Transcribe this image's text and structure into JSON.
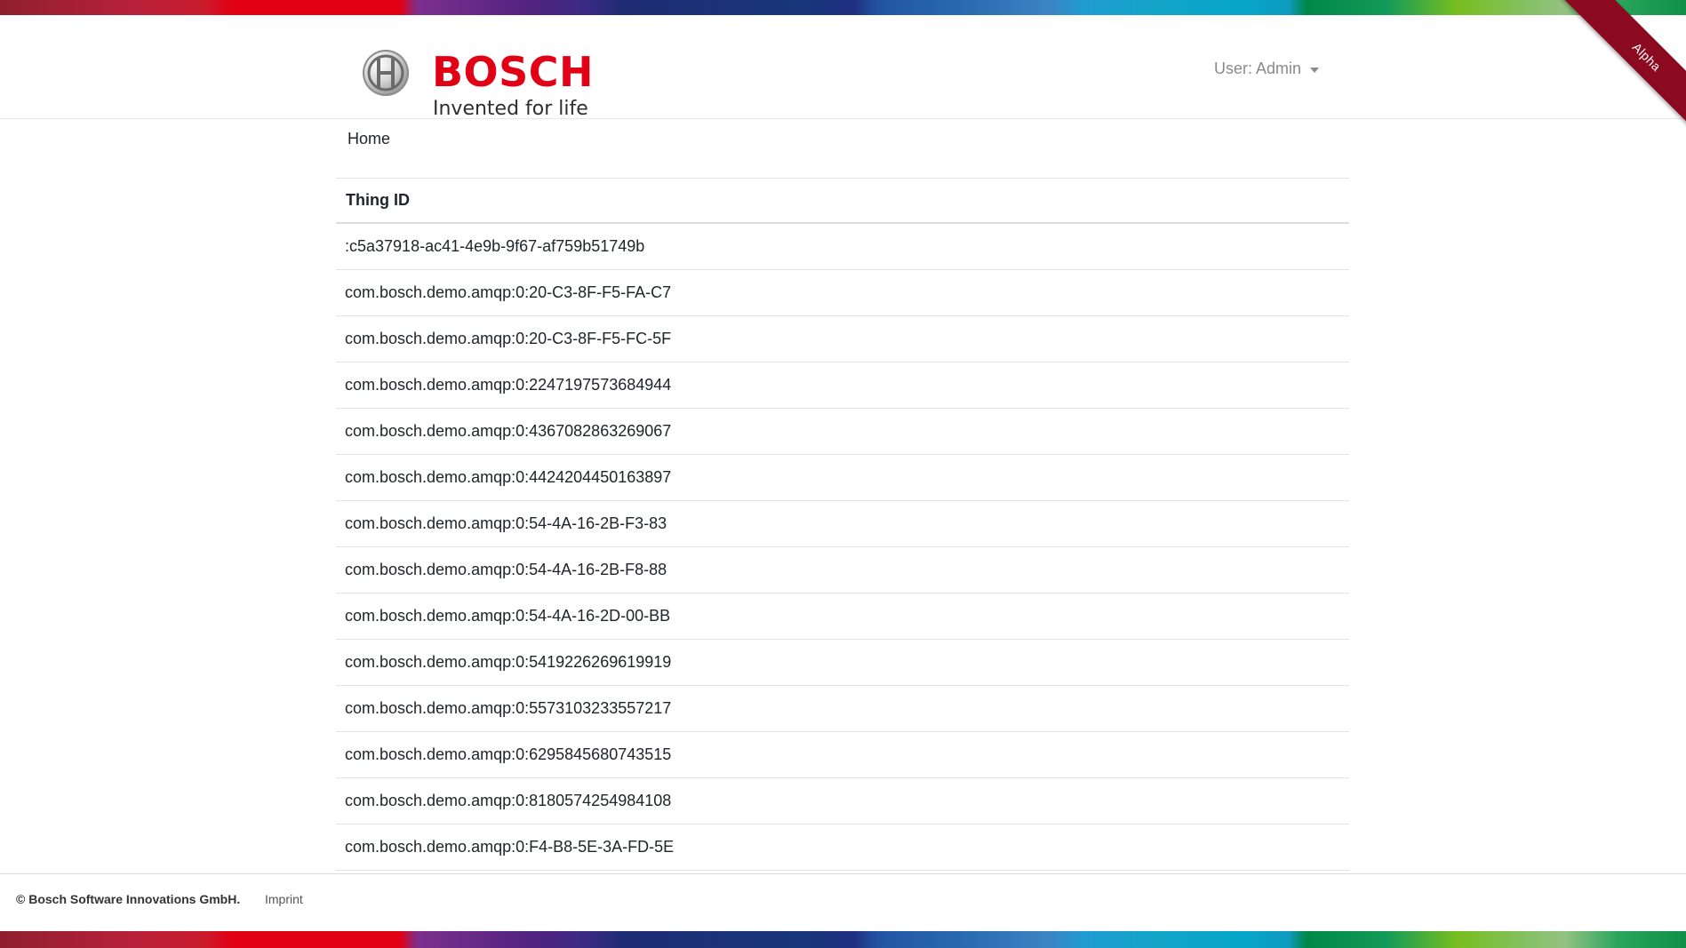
{
  "brand": {
    "name": "BOSCH",
    "tagline": "Invented for life",
    "color": "#e20015"
  },
  "header": {
    "user_menu_label": "User: Admin"
  },
  "ribbon": {
    "label": "Alpha",
    "color": "#8c0a1f"
  },
  "breadcrumb": {
    "home_label": "Home"
  },
  "table": {
    "header": "Thing ID",
    "rows": [
      ":c5a37918-ac41-4e9b-9f67-af759b51749b",
      "com.bosch.demo.amqp:0:20-C3-8F-F5-FA-C7",
      "com.bosch.demo.amqp:0:20-C3-8F-F5-FC-5F",
      "com.bosch.demo.amqp:0:2247197573684944",
      "com.bosch.demo.amqp:0:4367082863269067",
      "com.bosch.demo.amqp:0:4424204450163897",
      "com.bosch.demo.amqp:0:54-4A-16-2B-F3-83",
      "com.bosch.demo.amqp:0:54-4A-16-2B-F8-88",
      "com.bosch.demo.amqp:0:54-4A-16-2D-00-BB",
      "com.bosch.demo.amqp:0:5419226269619919",
      "com.bosch.demo.amqp:0:5573103233557217",
      "com.bosch.demo.amqp:0:6295845680743515",
      "com.bosch.demo.amqp:0:8180574254984108",
      "com.bosch.demo.amqp:0:F4-B8-5E-3A-FD-5E"
    ]
  },
  "footer": {
    "copyright": "© Bosch Software Innovations GmbH.",
    "imprint_label": "Imprint"
  },
  "icons": {
    "logo": "bosch-armature-icon",
    "user_caret": "chevron-down-icon"
  }
}
